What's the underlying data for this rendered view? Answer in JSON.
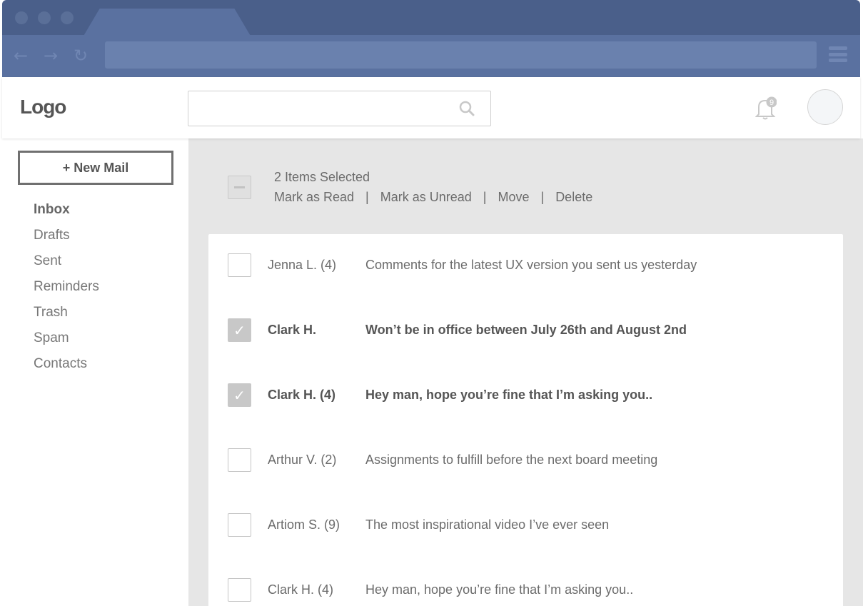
{
  "header": {
    "logo": "Logo",
    "search": {
      "placeholder": ""
    },
    "notifications_count": "9"
  },
  "sidebar": {
    "new_mail_label": "+ New Mail",
    "items": [
      {
        "label": "Inbox",
        "active": true
      },
      {
        "label": "Drafts"
      },
      {
        "label": "Sent"
      },
      {
        "label": "Reminders"
      },
      {
        "label": "Trash"
      },
      {
        "label": "Spam"
      },
      {
        "label": "Contacts"
      }
    ]
  },
  "selection": {
    "count_label": "2 Items Selected",
    "actions": [
      "Mark as Read",
      "Mark as Unread",
      "Move",
      "Delete"
    ],
    "separator": "|"
  },
  "emails": [
    {
      "sender": "Jenna L. (4)",
      "subject": "Comments for the latest UX version you sent us yesterday",
      "checked": false,
      "unread": false
    },
    {
      "sender": "Clark H.",
      "subject": "Won’t be in office between July 26th and August 2nd",
      "checked": true,
      "unread": true
    },
    {
      "sender": "Clark H. (4)",
      "subject": "Hey man, hope you’re fine that I’m asking you..",
      "checked": true,
      "unread": true
    },
    {
      "sender": "Arthur V. (2)",
      "subject": "Assignments to fulfill before the next board meeting",
      "checked": false,
      "unread": false
    },
    {
      "sender": "Artiom S. (9)",
      "subject": "The most inspirational video I’ve ever seen",
      "checked": false,
      "unread": false
    },
    {
      "sender": "Clark H. (4)",
      "subject": "Hey man, hope you’re fine that I’m asking you..",
      "checked": false,
      "unread": false
    }
  ],
  "icons": {
    "back": "back-arrow-icon",
    "forward": "forward-arrow-icon",
    "reload": "reload-icon",
    "menu": "hamburger-menu-icon",
    "search": "search-icon",
    "bell": "bell-icon",
    "check": "checkmark-icon"
  }
}
